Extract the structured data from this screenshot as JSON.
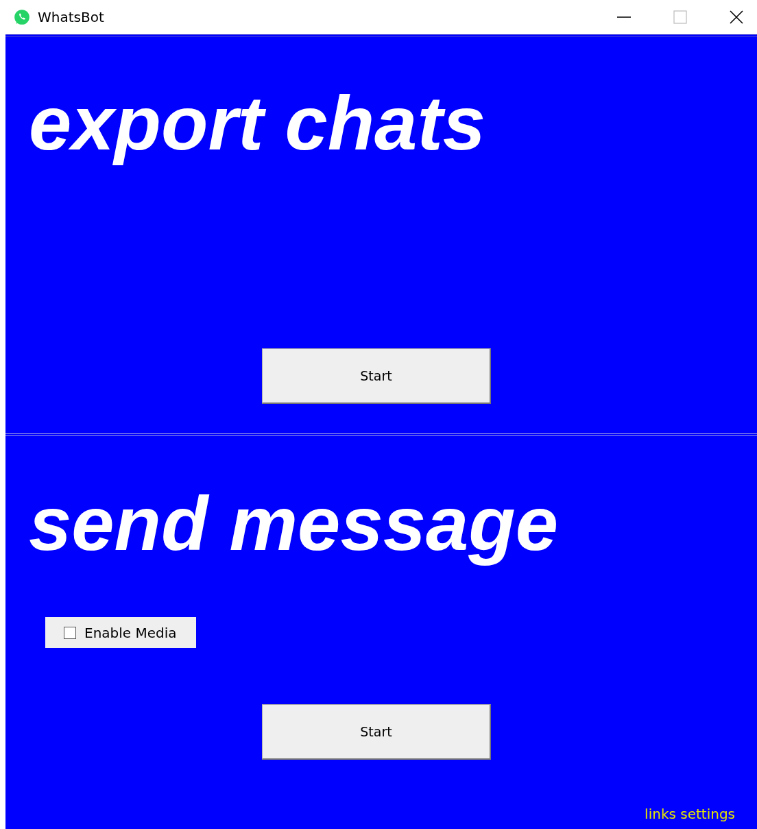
{
  "window": {
    "title": "WhatsBot"
  },
  "sections": [
    {
      "title": "export chats",
      "button": "Start"
    },
    {
      "title": "send message",
      "options": [
        {
          "label": "Enable Media",
          "checked": false
        }
      ],
      "button": "Start"
    }
  ],
  "footer_link": "links settings"
}
